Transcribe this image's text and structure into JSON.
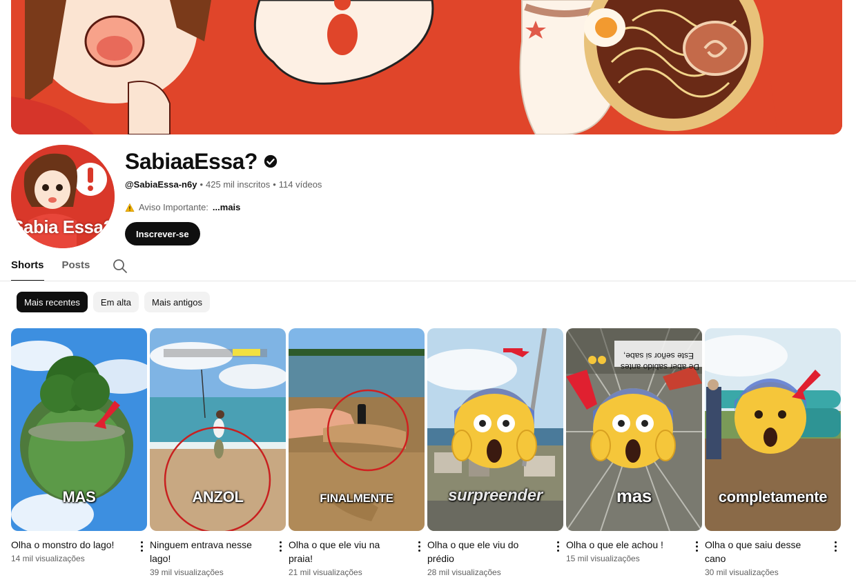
{
  "channel": {
    "name": "SabiaaEssa?",
    "handle": "@SabiaEssa-n6y",
    "subscribers": "425 mil inscritos",
    "videos": "114 vídeos",
    "notice_label": "Aviso Importante:",
    "notice_more": "...mais",
    "subscribe_label": "Inscrever-se",
    "avatar_text": "Sabia Essa?"
  },
  "tabs": [
    {
      "label": "Shorts",
      "active": true
    },
    {
      "label": "Posts",
      "active": false
    }
  ],
  "chips": [
    {
      "label": "Mais recentes",
      "active": true
    },
    {
      "label": "Em alta",
      "active": false
    },
    {
      "label": "Mais antigos",
      "active": false
    }
  ],
  "shorts": [
    {
      "overlay": "MAS",
      "title": "Olha o monstro do lago!",
      "views": "14 mil visualizações"
    },
    {
      "overlay": "ANZOL",
      "title": "Ninguem entrava nesse lago!",
      "views": "39 mil visualizações"
    },
    {
      "overlay": "FINALMENTE",
      "title": "Olha o que ele viu na praia!",
      "views": "21 mil visualizações"
    },
    {
      "overlay": "surpreender",
      "title": "Olha o que ele viu do prédio",
      "views": "28 mil visualizações"
    },
    {
      "overlay": "mas",
      "title": "Olha o que ele achou !",
      "views": "15 mil visualizações",
      "caption_line1": "Este señor si sabe,",
      "caption_line2": "De aber sabido antes"
    },
    {
      "overlay": "completamente",
      "title": "Olha o que saiu desse cano",
      "views": "30 mil visualizações"
    }
  ],
  "colors": {
    "banner": "#e0452a",
    "subscribe_bg": "#0f0f0f",
    "chip_bg": "#f2f2f2"
  }
}
